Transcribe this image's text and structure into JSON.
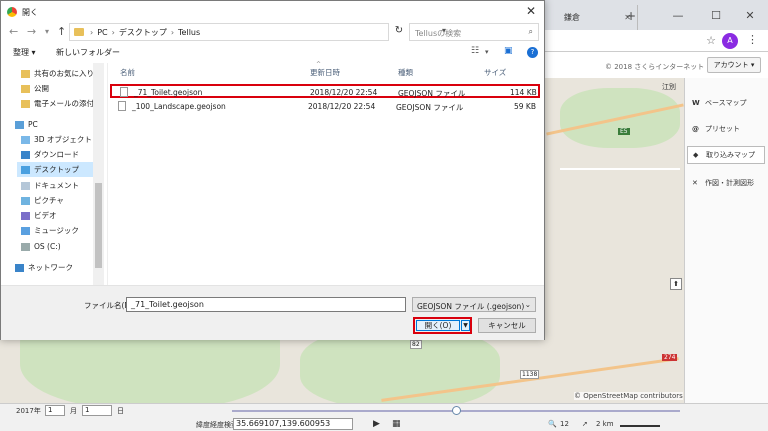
{
  "browser": {
    "tab2_title": "鎌倉 ",
    "new_tab": "+",
    "avatar_letter": "A",
    "min": "—",
    "max": "☐",
    "close": "✕"
  },
  "page": {
    "copyright": "© 2018 さくらインターネット",
    "account_button": "アカウント ▾",
    "map_labels": [
      "E5",
      "274",
      "1138",
      "82",
      "江別"
    ],
    "osm_attribution": "© OpenStreetMap contributors",
    "side_panel": [
      {
        "icon": "W",
        "label": "ベースマップ"
      },
      {
        "icon": "@",
        "label": "プリセット"
      },
      {
        "icon": "◆",
        "label": "取り込みマップ"
      },
      {
        "icon": "✕",
        "label": "作図・計測図形"
      }
    ],
    "bottom": {
      "year": "2017年",
      "month_value": "1",
      "month_unit": "月",
      "day_value": "1",
      "day_unit": "日",
      "latlon_label": "緯度経度検索",
      "latlon_value": "35.669107,139.600953",
      "zoom": "12",
      "scale": "2 km"
    }
  },
  "dialog": {
    "title": "開く",
    "close": "✕",
    "path": [
      "PC",
      "デスクトップ",
      "Tellus"
    ],
    "search_placeholder": "Tellusの検索",
    "toolbar": {
      "organize": "整理 ▾",
      "new_folder": "新しいフォルダー"
    },
    "nav_items": [
      {
        "label": "共有のお気に入り",
        "icon": "folder"
      },
      {
        "label": "公開",
        "icon": "folder"
      },
      {
        "label": "電子メールの添付",
        "icon": "folder"
      },
      {
        "label": "PC",
        "icon": "pc"
      },
      {
        "label": "3D オブジェクト",
        "icon": "3d"
      },
      {
        "label": "ダウンロード",
        "icon": "download"
      },
      {
        "label": "デスクトップ",
        "icon": "desktop"
      },
      {
        "label": "ドキュメント",
        "icon": "doc"
      },
      {
        "label": "ピクチャ",
        "icon": "pic"
      },
      {
        "label": "ビデオ",
        "icon": "video"
      },
      {
        "label": "ミュージック",
        "icon": "music"
      },
      {
        "label": "OS (C:)",
        "icon": "drive"
      },
      {
        "label": "ネットワーク",
        "icon": "network"
      }
    ],
    "columns": {
      "name": "名前",
      "modified": "更新日時",
      "type": "種類",
      "size": "サイズ"
    },
    "files": [
      {
        "name": "_71_Toilet.geojson",
        "modified": "2018/12/20 22:54",
        "type": "GEOJSON ファイル",
        "size": "114 KB"
      },
      {
        "name": "_100_Landscape.geojson",
        "modified": "2018/12/20 22:54",
        "type": "GEOJSON ファイル",
        "size": "59 KB"
      }
    ],
    "filename_label": "ファイル名(N):",
    "filename_value": "_71_Toilet.geojson",
    "filetype": "GEOJSON ファイル (.geojson)",
    "open_button": "開く(O)",
    "cancel_button": "キャンセル"
  }
}
